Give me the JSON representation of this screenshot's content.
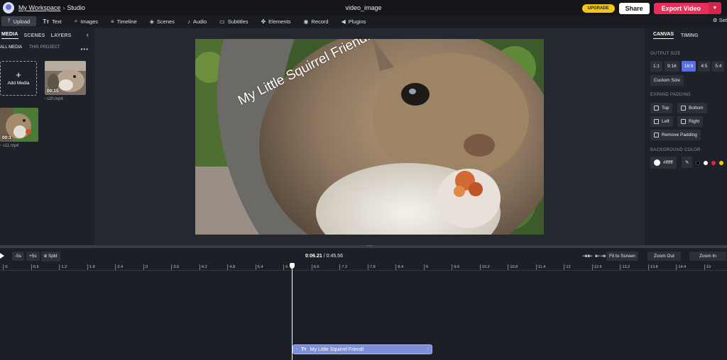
{
  "header": {
    "workspace": "My Workspace",
    "separator": "›",
    "section": "Studio",
    "title": "video_image",
    "upgrade_label": "UPGRADE",
    "share_label": "Share",
    "export_label": "Export Video"
  },
  "toolbar": {
    "items": [
      {
        "label": "Upload",
        "icon": "upload-icon"
      },
      {
        "label": "Text",
        "icon": "text-icon"
      },
      {
        "label": "Images",
        "icon": "search-icon"
      },
      {
        "label": "Timeline",
        "icon": "timeline-icon"
      },
      {
        "label": "Scenes",
        "icon": "layers-icon"
      },
      {
        "label": "Audio",
        "icon": "music-note-icon"
      },
      {
        "label": "Subtitles",
        "icon": "subtitles-icon"
      },
      {
        "label": "Elements",
        "icon": "shapes-icon"
      },
      {
        "label": "Record",
        "icon": "record-icon"
      },
      {
        "label": "Plugins",
        "icon": "megaphone-icon"
      }
    ],
    "settings_label": "Set"
  },
  "left_panel": {
    "tabs": [
      "MEDIA",
      "SCENES",
      "LAYERS"
    ],
    "subtabs": [
      "ALL MEDIA",
      "THIS PROJECT"
    ],
    "add_media_label": "Add Media",
    "media": [
      {
        "duration": "00:15",
        "filename": "s20.mp4"
      },
      {
        "duration": "00:1",
        "filename": "s11.mp4"
      }
    ]
  },
  "canvas": {
    "overlay_text": "My Little Squirrel Friend!"
  },
  "right_panel": {
    "tabs": [
      "CANVAS",
      "TIMING"
    ],
    "output_size_label": "OUTPUT SIZE",
    "ratios": [
      "1:1",
      "9:16",
      "16:9",
      "4:5",
      "5:4"
    ],
    "selected_ratio": "16:9",
    "custom_size_label": "Custom Size",
    "expand_padding_label": "EXPAND PADDING",
    "padding": {
      "top": "Top",
      "bottom": "Bottom",
      "left": "Left",
      "right": "Right",
      "remove": "Remove Padding"
    },
    "background_color_label": "BACKGROUND COLOR",
    "background_color": "#ffffff",
    "swatches": [
      "#000000",
      "#ffffff",
      "#e8253a",
      "#f5c518",
      "#2f6fde"
    ]
  },
  "timeline": {
    "back_label": "-5s",
    "forward_label": "+5s",
    "split_label": "Split",
    "current_time": "0:06.21",
    "time_sep": "/",
    "total_time": "0:45.56",
    "fit_label": "Fit to Screen",
    "zoom_out_label": "Zoom Out",
    "zoom_in_label": "Zoom In",
    "ticks": [
      ":0",
      ":0.6",
      ":1.2",
      ":1.8",
      ":2.4",
      ":3",
      ":3.6",
      ":4.2",
      ":4.8",
      ":5.4",
      ":6",
      ":6.6",
      ":7.2",
      ":7.8",
      ":8.4",
      ":9",
      ":9.6",
      ":10.2",
      ":10.8",
      ":11.4",
      ":12",
      ":12.6",
      ":13.2",
      ":13.8",
      ":14.4",
      ":15"
    ],
    "clip_label": "My Little Squirrel Friend!",
    "clip_icon": "text-icon"
  }
}
